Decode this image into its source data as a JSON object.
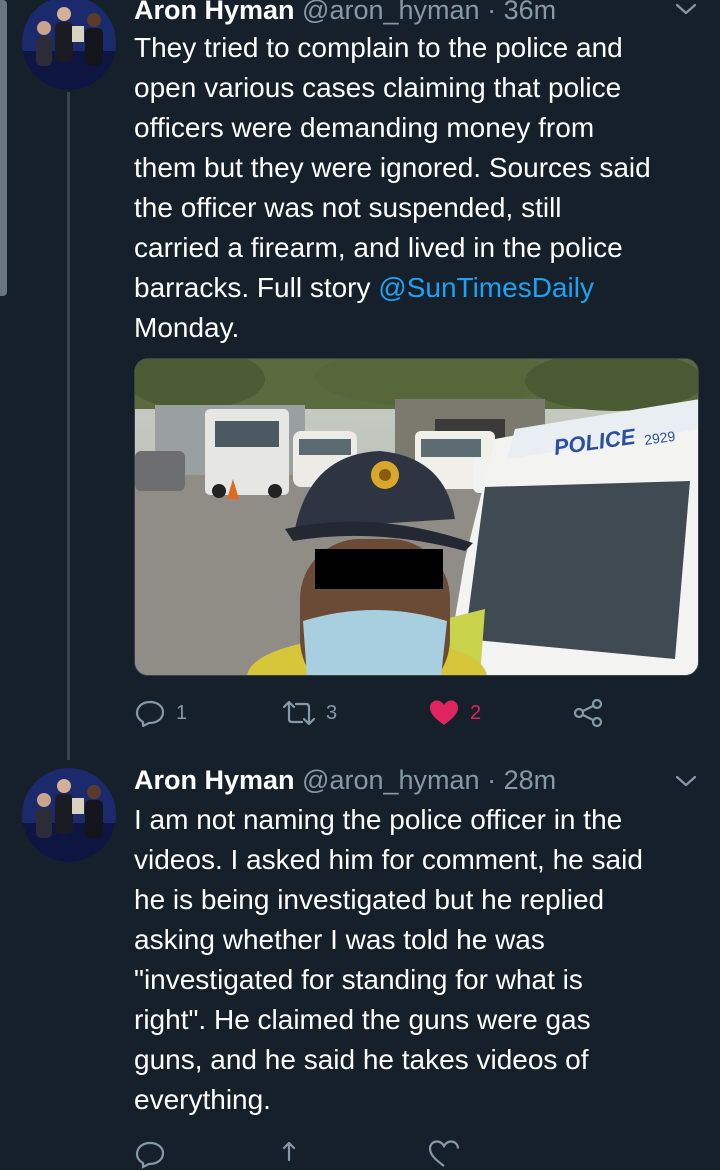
{
  "tweets": [
    {
      "name": "Aron Hyman",
      "handle": "@aron_hyman",
      "separator": "·",
      "time": "36m",
      "text_lines": [
        "They tried to complain to the police and",
        "open various cases claiming that police",
        "officers were demanding money from",
        "them but they were ignored. Sources said",
        "the officer was not suspended, still",
        "carried a firearm, and lived in the police"
      ],
      "text_last_prefix": "barracks. Full story ",
      "mention": "@SunTimesDaily",
      "text_after_mention": "Monday.",
      "media": {
        "van_text": "POLICE",
        "van_number": "2929"
      },
      "actions": {
        "replies": "1",
        "retweets": "3",
        "likes": "2"
      },
      "like_color": "#e0245e"
    },
    {
      "name": "Aron Hyman",
      "handle": "@aron_hyman",
      "separator": "·",
      "time": "28m",
      "text_lines": [
        "I am not naming the police officer in the",
        "videos. I asked him for comment, he said",
        "he is being investigated but he replied",
        "asking whether I was told he was",
        "\"investigated for standing for what is",
        "right\". He claimed the guns were gas",
        "guns, and he said he takes videos of",
        "everything."
      ]
    }
  ],
  "colors": {
    "background": "#15202b",
    "primary_text": "#ffffff",
    "secondary_text": "#8899a6",
    "link": "#1da1f2",
    "like": "#e0245e",
    "divider": "#38444d"
  }
}
